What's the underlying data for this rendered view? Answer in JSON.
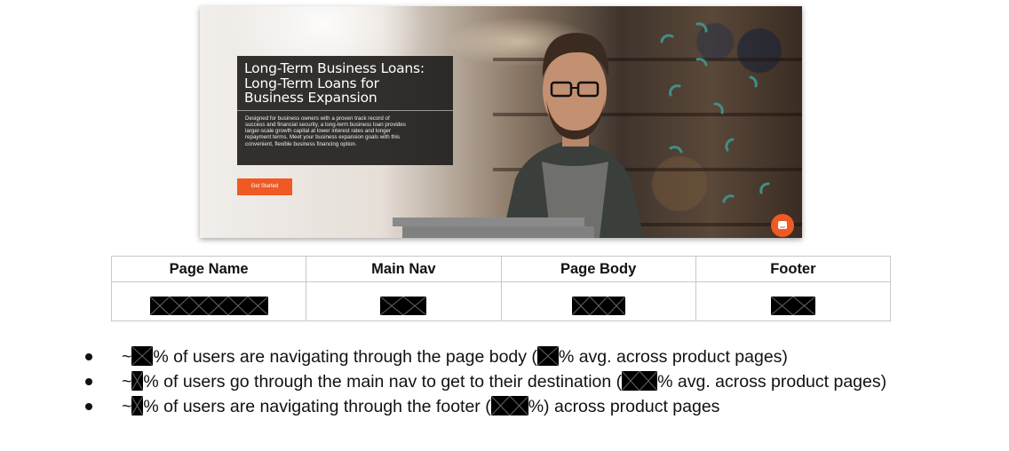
{
  "hero": {
    "title": "Long-Term Business Loans:\nLong-Term Loans for\nBusiness Expansion",
    "description": "Designed for business owners with a proven track record of\nsuccess and financial security, a long-term business loan provides\nlarger-scale growth capital at lower interest rates and longer\nrepayment terms. Meet your business expansion goals with this\nconvenient, flexible business financing option.",
    "cta_label": "Get Started",
    "accent_color": "#ef5a24",
    "chat_icon": "chat-icon"
  },
  "table": {
    "headers": [
      "Page Name",
      "Main Nav",
      "Page Body",
      "Footer"
    ]
  },
  "bullets": [
    {
      "prefix": "~",
      "part1": "% of users are navigating through the page body (",
      "part2": "% avg. across product pages)"
    },
    {
      "prefix": "~",
      "part1": "% of users go through the main nav to get to their destination (",
      "part2": "% avg. across product pages)"
    },
    {
      "prefix": "~",
      "part1": "% of users are navigating through the  footer (",
      "part2": "%) across product pages"
    }
  ]
}
